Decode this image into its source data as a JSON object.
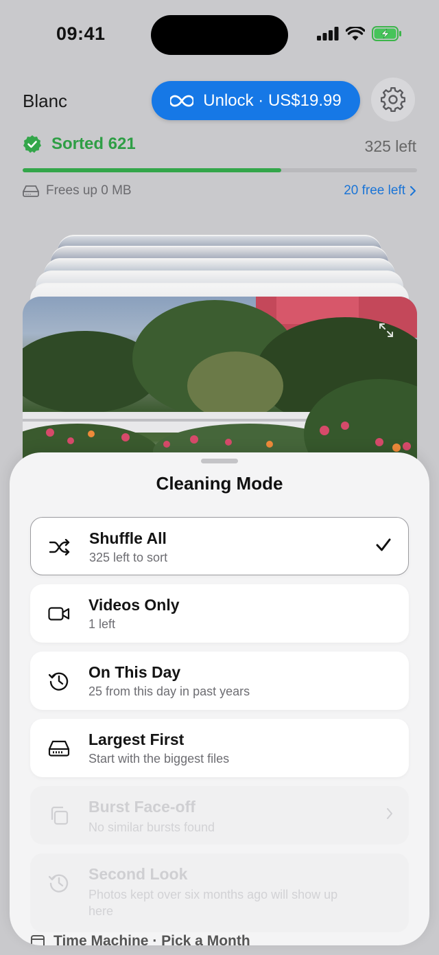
{
  "status": {
    "time": "09:41"
  },
  "header": {
    "app_name": "Blanc",
    "unlock_label": "Unlock · US$19.99"
  },
  "progress": {
    "sorted_label": "Sorted 621",
    "left_label": "325 left",
    "fraction": 0.656,
    "frees_label": "Frees up 0 MB",
    "free_left_label": "20 free left"
  },
  "sheet": {
    "title": "Cleaning Mode",
    "modes": [
      {
        "title": "Shuffle All",
        "subtitle": "325 left to sort",
        "selected": true
      },
      {
        "title": "Videos Only",
        "subtitle": "1 left"
      },
      {
        "title": "On This Day",
        "subtitle": "25 from this day in past years"
      },
      {
        "title": "Largest First",
        "subtitle": "Start with the biggest files"
      },
      {
        "title": "Burst Face-off",
        "subtitle": "No similar bursts found",
        "disabled": true
      },
      {
        "title": "Second Look",
        "subtitle": "Photos kept over six months ago will show up here",
        "disabled": true
      }
    ],
    "time_machine_label": "Time Machine · Pick a Month"
  },
  "colors": {
    "accent": "#1678e6",
    "success": "#33a64a",
    "link": "#1a74d6"
  }
}
